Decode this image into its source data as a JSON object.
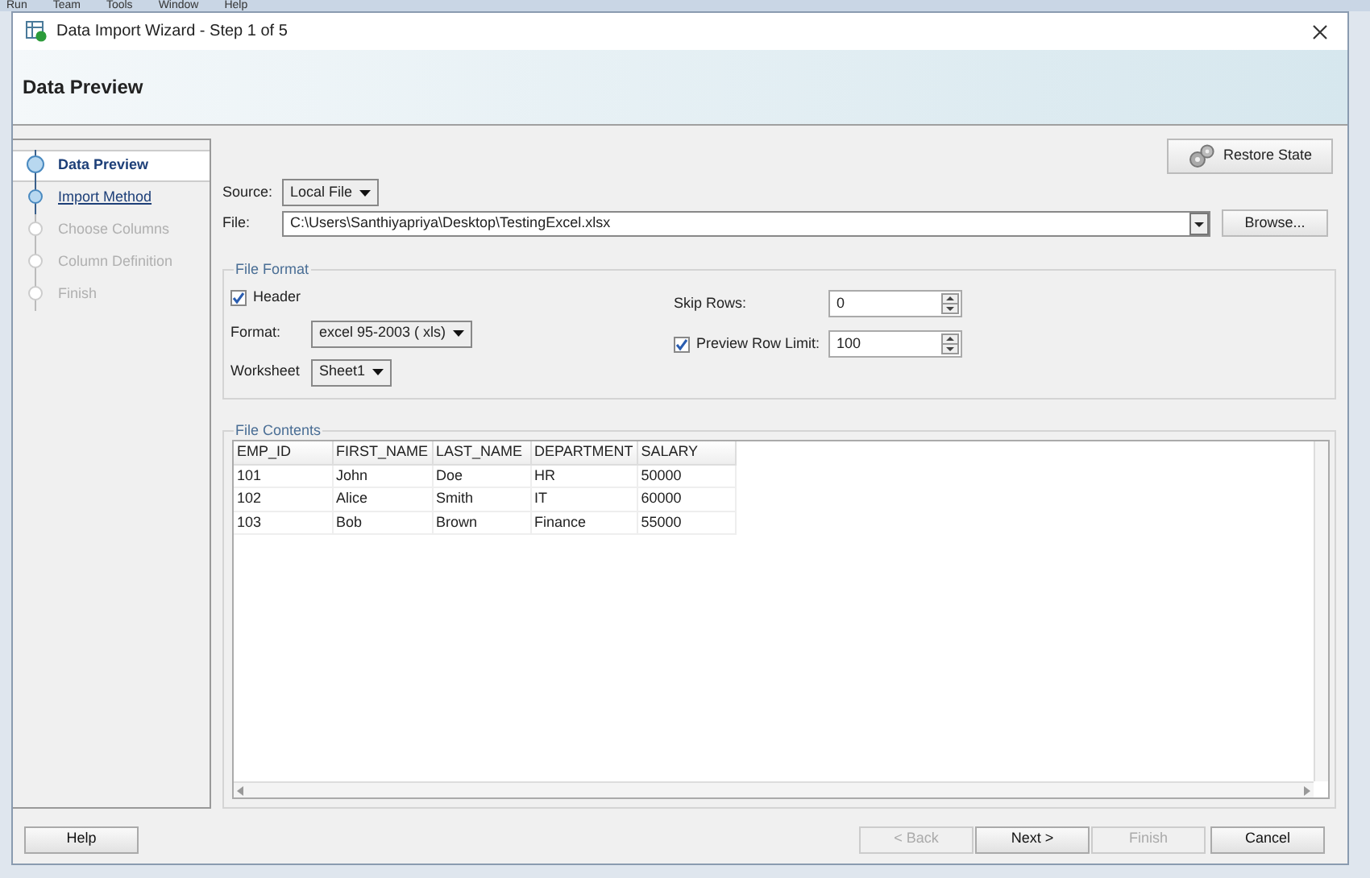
{
  "background_menu": [
    "Run",
    "Team",
    "Tools",
    "Window",
    "Help"
  ],
  "window": {
    "title": "Data Import Wizard - Step 1 of 5"
  },
  "header": {
    "title": "Data Preview"
  },
  "steps": [
    {
      "label": "Data Preview",
      "selected": true,
      "disabled": false
    },
    {
      "label": "Import Method",
      "selected": false,
      "disabled": false
    },
    {
      "label": "Choose Columns",
      "selected": false,
      "disabled": true
    },
    {
      "label": "Column Definition",
      "selected": false,
      "disabled": true
    },
    {
      "label": "Finish",
      "selected": false,
      "disabled": true
    }
  ],
  "restore_button": "Restore State",
  "source": {
    "label": "Source:",
    "value": "Local File"
  },
  "file": {
    "label": "File:",
    "value": "C:\\Users\\Santhiyapriya\\Desktop\\TestingExcel.xlsx",
    "browse": "Browse..."
  },
  "file_format": {
    "title": "File Format",
    "header": {
      "label": "Header",
      "checked": true
    },
    "format": {
      "label": "Format:",
      "value": "excel 95-2003 ( xls)"
    },
    "worksheet": {
      "label": "Worksheet",
      "value": "Sheet1"
    },
    "skip_rows": {
      "label": "Skip Rows:",
      "value": "0"
    },
    "preview_row_limit": {
      "label": "Preview Row Limit:",
      "checked": true,
      "value": "100"
    }
  },
  "file_contents": {
    "title": "File Contents",
    "columns": [
      "EMP_ID",
      "FIRST_NAME",
      "LAST_NAME",
      "DEPARTMENT",
      "SALARY"
    ],
    "rows": [
      [
        "101",
        "John",
        "Doe",
        "HR",
        "50000"
      ],
      [
        "102",
        "Alice",
        "Smith",
        "IT",
        "60000"
      ],
      [
        "103",
        "Bob",
        "Brown",
        "Finance",
        "55000"
      ]
    ]
  },
  "buttons": [
    {
      "label": "Help",
      "disabled": false
    },
    {
      "label": "< Back",
      "disabled": true
    },
    {
      "label": "Next >",
      "disabled": false
    },
    {
      "label": "Finish",
      "disabled": true
    },
    {
      "label": "Cancel",
      "disabled": false
    }
  ]
}
